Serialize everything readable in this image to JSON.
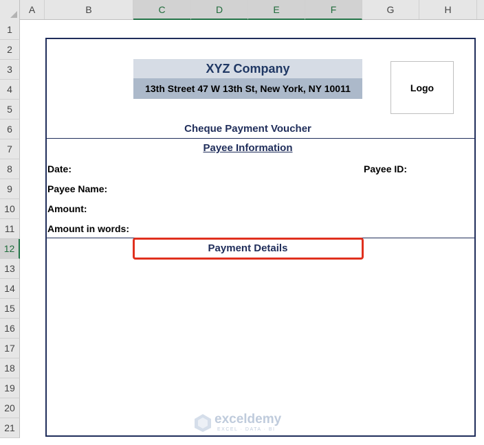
{
  "sheet": {
    "columns": [
      "A",
      "B",
      "C",
      "D",
      "E",
      "F",
      "G",
      "H"
    ],
    "selected_columns": [
      "C",
      "D",
      "E",
      "F"
    ],
    "rows": [
      "1",
      "2",
      "3",
      "4",
      "5",
      "6",
      "7",
      "8",
      "9",
      "10",
      "11",
      "12",
      "13",
      "14",
      "15",
      "16",
      "17",
      "18",
      "19",
      "20",
      "21"
    ],
    "selected_row": "12"
  },
  "voucher": {
    "company_name": "XYZ Company",
    "company_address": "13th Street 47 W 13th St, New York, NY 10011",
    "logo_label": "Logo",
    "title": "Cheque Payment Voucher",
    "payee_section_title": "Payee Information",
    "fields": {
      "date": "Date:",
      "payee_id": "Payee ID:",
      "payee_name": "Payee Name:",
      "amount": "Amount:",
      "amount_words": "Amount in words:"
    },
    "payment_section_title": "Payment Details"
  },
  "watermark": {
    "name": "exceldemy",
    "tagline": "EXCEL · DATA · BI"
  },
  "colors": {
    "accent_navy": "#1f2d5a",
    "highlight_red": "#e0301e",
    "title_band": "#d6dce5",
    "address_band": "#acb9ca",
    "excel_green": "#217346"
  }
}
